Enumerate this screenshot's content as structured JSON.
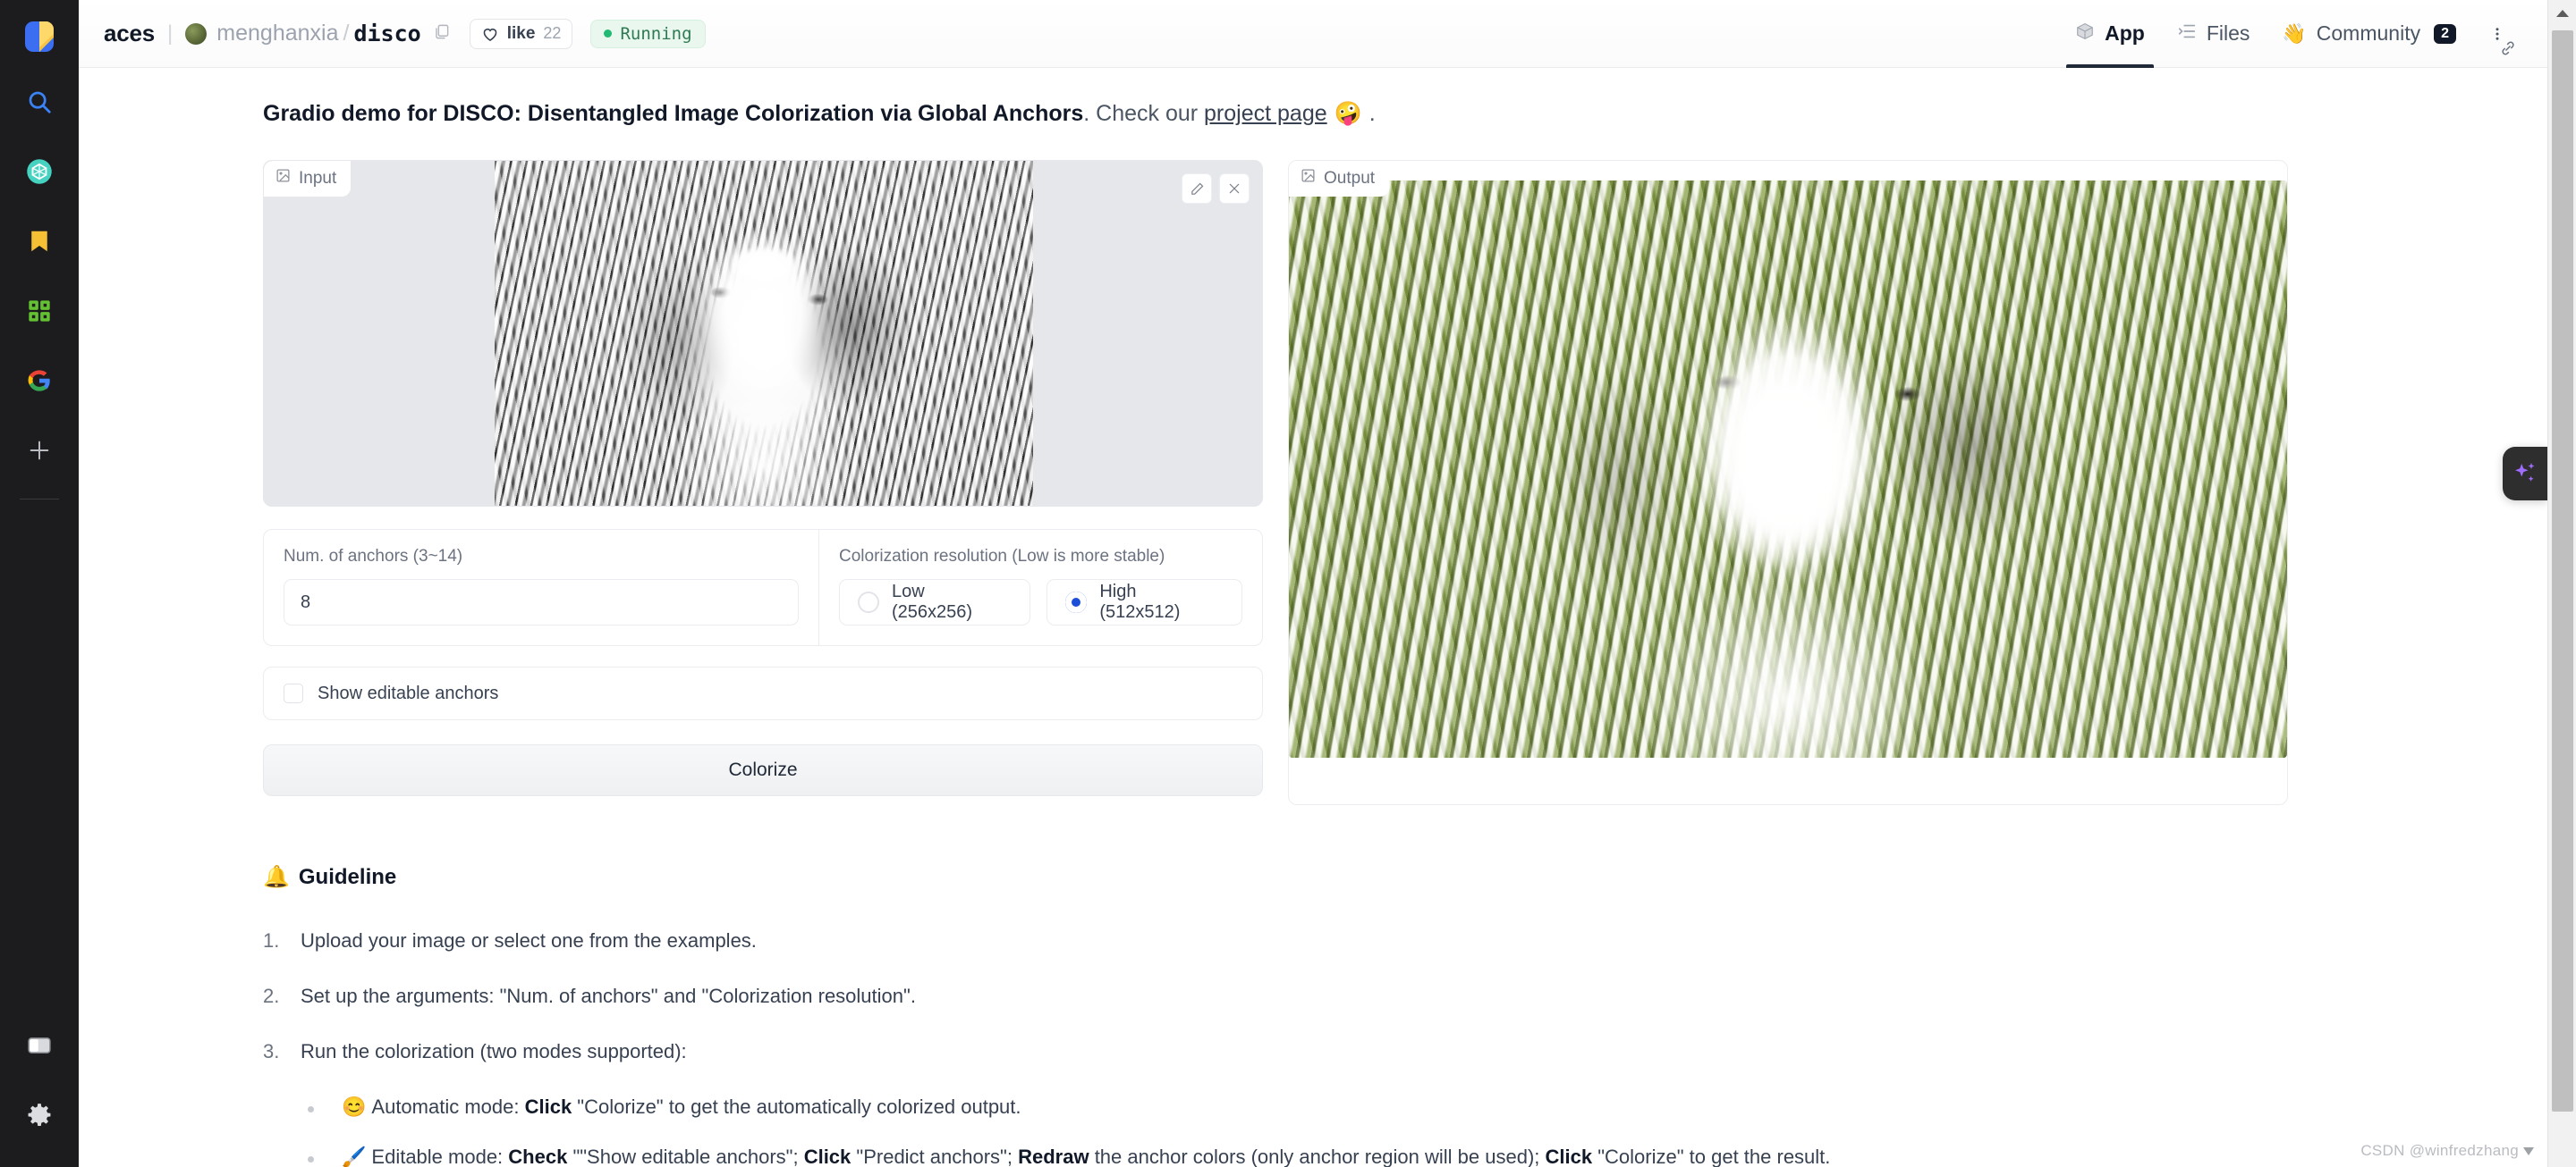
{
  "browser_rail": {
    "logo_name": "copilot-logo",
    "items": [
      {
        "name": "search-icon",
        "label": "Search"
      },
      {
        "name": "openai-icon",
        "label": "OpenAI"
      },
      {
        "name": "bookmark-icon",
        "label": "Bookmarks"
      },
      {
        "name": "apps-grid-icon",
        "label": "Apps"
      },
      {
        "name": "google-icon",
        "label": "Google"
      },
      {
        "name": "add-icon",
        "label": "Add"
      }
    ],
    "bottom_items": [
      {
        "name": "split-view-icon",
        "label": "Split view"
      },
      {
        "name": "settings-gear-icon",
        "label": "Settings"
      }
    ]
  },
  "header": {
    "breadcrumb_spaces": "aces",
    "separator": "|",
    "owner": "menghanxia",
    "slash": "/",
    "repo": "disco",
    "copy_icon": "copy-icon",
    "like_label": "like",
    "like_count": "22",
    "status_label": "Running",
    "status_color": "#2f7a53",
    "tabs": [
      {
        "name": "tab-app",
        "icon": "cube-icon",
        "label": "App",
        "active": true,
        "badge": ""
      },
      {
        "name": "tab-files",
        "icon": "file-tree-icon",
        "label": "Files",
        "active": false,
        "badge": ""
      },
      {
        "name": "tab-community",
        "icon": "wave-hand-icon",
        "label": "Community",
        "active": false,
        "badge": "2"
      }
    ],
    "kebab_label": "More options"
  },
  "app": {
    "description_bold": "Gradio demo for DISCO: Disentangled Image Colorization via Global Anchors",
    "description_rest_1": ". Check our ",
    "description_link": "project page",
    "description_emoji": "🤪",
    "description_rest_2": ".",
    "input_panel": {
      "tag_label": "Input",
      "tag_icon": "image-icon",
      "edit_icon": "pencil-icon",
      "clear_icon": "close-icon"
    },
    "output_panel": {
      "tag_label": "Output",
      "tag_icon": "image-icon"
    },
    "anchors": {
      "label": "Num. of anchors (3~14)",
      "value": "8",
      "placeholder": ""
    },
    "resolution": {
      "label": "Colorization resolution (Low is more stable)",
      "options": [
        {
          "label": "Low (256x256)",
          "checked": false
        },
        {
          "label": "High (512x512)",
          "checked": true
        }
      ],
      "accent": "#1d4ed8"
    },
    "show_anchors": {
      "label": "Show editable anchors",
      "checked": false
    },
    "colorize_button": "Colorize",
    "guideline": {
      "emoji": "🔔",
      "title": "Guideline",
      "steps": [
        "Upload your image or select one from the examples.",
        "Set up the arguments: \"Num. of anchors\" and \"Colorization resolution\".",
        "Run the colorization (two modes supported):"
      ],
      "modes": [
        {
          "emoji": "😊",
          "prefix": "Automatic mode: ",
          "strong_1": "Click",
          "mid_1": " \"Colorize\" to get the automatically colorized output.",
          "strong_2": "",
          "mid_2": "",
          "strong_3": "",
          "mid_3": "",
          "strong_4": "",
          "mid_4": ""
        },
        {
          "emoji": "🖌️",
          "prefix": "Editable mode: ",
          "strong_1": "Check",
          "mid_1": " \"\"Show editable anchors\"; ",
          "strong_2": "Click",
          "mid_2": " \"Predict anchors\"; ",
          "strong_3": "Redraw",
          "mid_3": " the anchor colors (only anchor region will be used); ",
          "strong_4": "Click",
          "mid_4": " \"Colorize\" to get the result."
        }
      ]
    }
  },
  "ai_fab": {
    "name": "sparkle-icon",
    "color": "#a06cff"
  },
  "scrollbar": {
    "up_arrow": "scroll-up-arrow"
  },
  "watermark": {
    "text": "CSDN @winfredzhang"
  }
}
